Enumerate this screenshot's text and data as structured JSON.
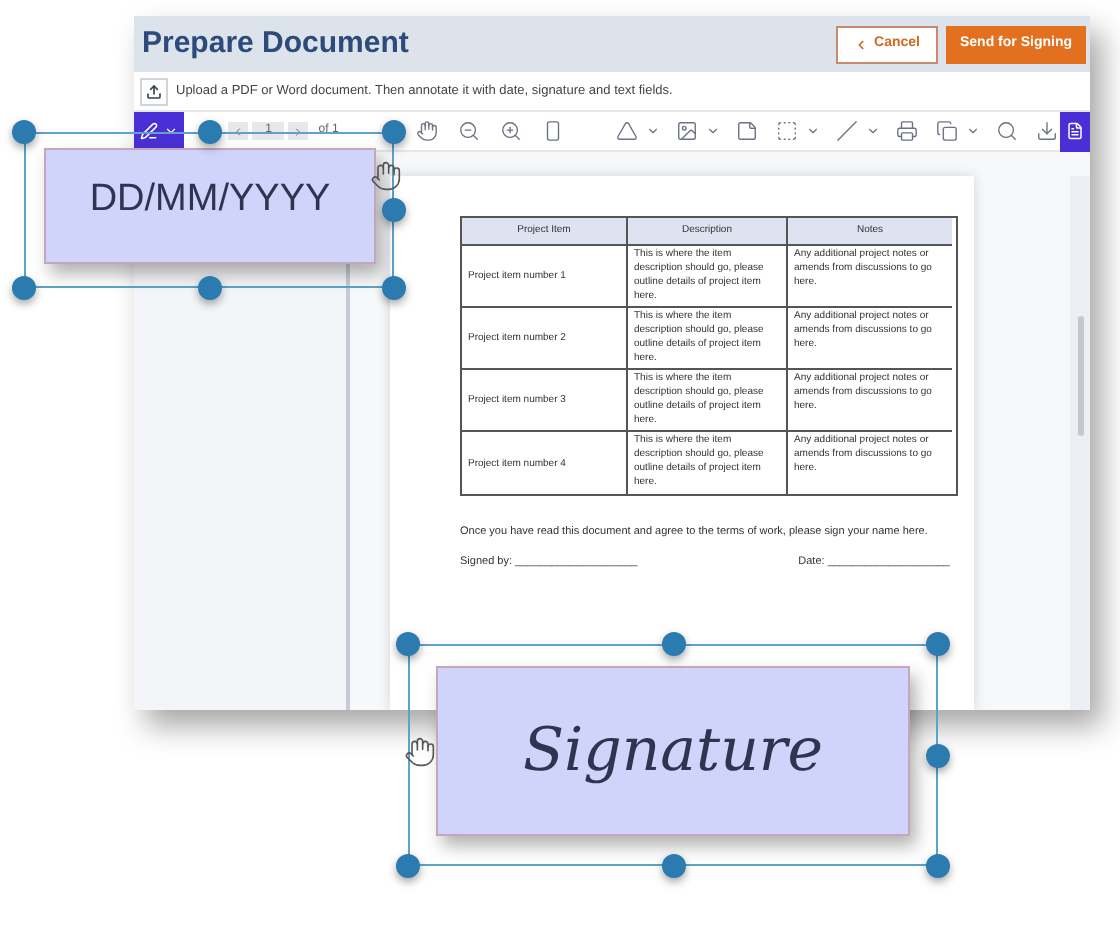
{
  "header": {
    "title": "Prepare Document",
    "buttons": [
      {
        "label": "Cancel",
        "kind": "outline"
      },
      {
        "label": "Send for Signing",
        "kind": "primary"
      }
    ]
  },
  "upload_hint": "Upload a PDF or Word document. Then annotate it with date, signature and text fields.",
  "toolbar": {
    "page_number": "1",
    "page_count": "of 1"
  },
  "document": {
    "table": {
      "columns": [
        "Project Item",
        "Description",
        "Notes"
      ],
      "rows": [
        [
          "Project item number 1",
          "This is where the item description should go, please outline details of project item here.",
          "Any additional project notes or amends from discussions to go here."
        ],
        [
          "Project item number 2",
          "This is where the item description should go, please outline details of project item here.",
          "Any additional project notes or amends from discussions to go here."
        ],
        [
          "Project item number 3",
          "This is where the item description should go, please outline details of project item here.",
          "Any additional project notes or amends from discussions to go here."
        ],
        [
          "Project item number 4",
          "This is where the item description should go, please outline details of project item here.",
          "Any additional project notes or amends from discussions to go here."
        ]
      ]
    },
    "agreement": "Once you have read this document and agree to the terms of work, please sign your name here.",
    "signed_by": "Signed by: ____________________",
    "date_label": "Date: ____________________"
  },
  "fields": [
    {
      "kind": "date",
      "placeholder": "DD/MM/YYYY"
    },
    {
      "kind": "signature",
      "placeholder": "Signature"
    }
  ]
}
